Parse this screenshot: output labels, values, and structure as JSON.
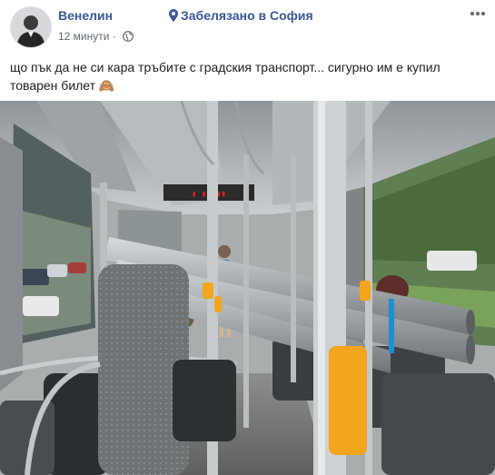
{
  "post": {
    "author": "Венелин",
    "location": "Забелязано в София",
    "time": "12 минути",
    "text": "що пък да не си кара тръбите с градския транспорт... сигурно им е купил товарен билет 🙈"
  },
  "bus_display": {
    "text": "▮ ▮▮ ▮▮",
    "accent": "#d8231c"
  },
  "colors": {
    "link": "#385898",
    "meta": "#616770",
    "text": "#1c1e21"
  },
  "icons": {
    "location": "pin-icon",
    "privacy": "globe-icon",
    "menu": "more-horizontal-icon"
  }
}
